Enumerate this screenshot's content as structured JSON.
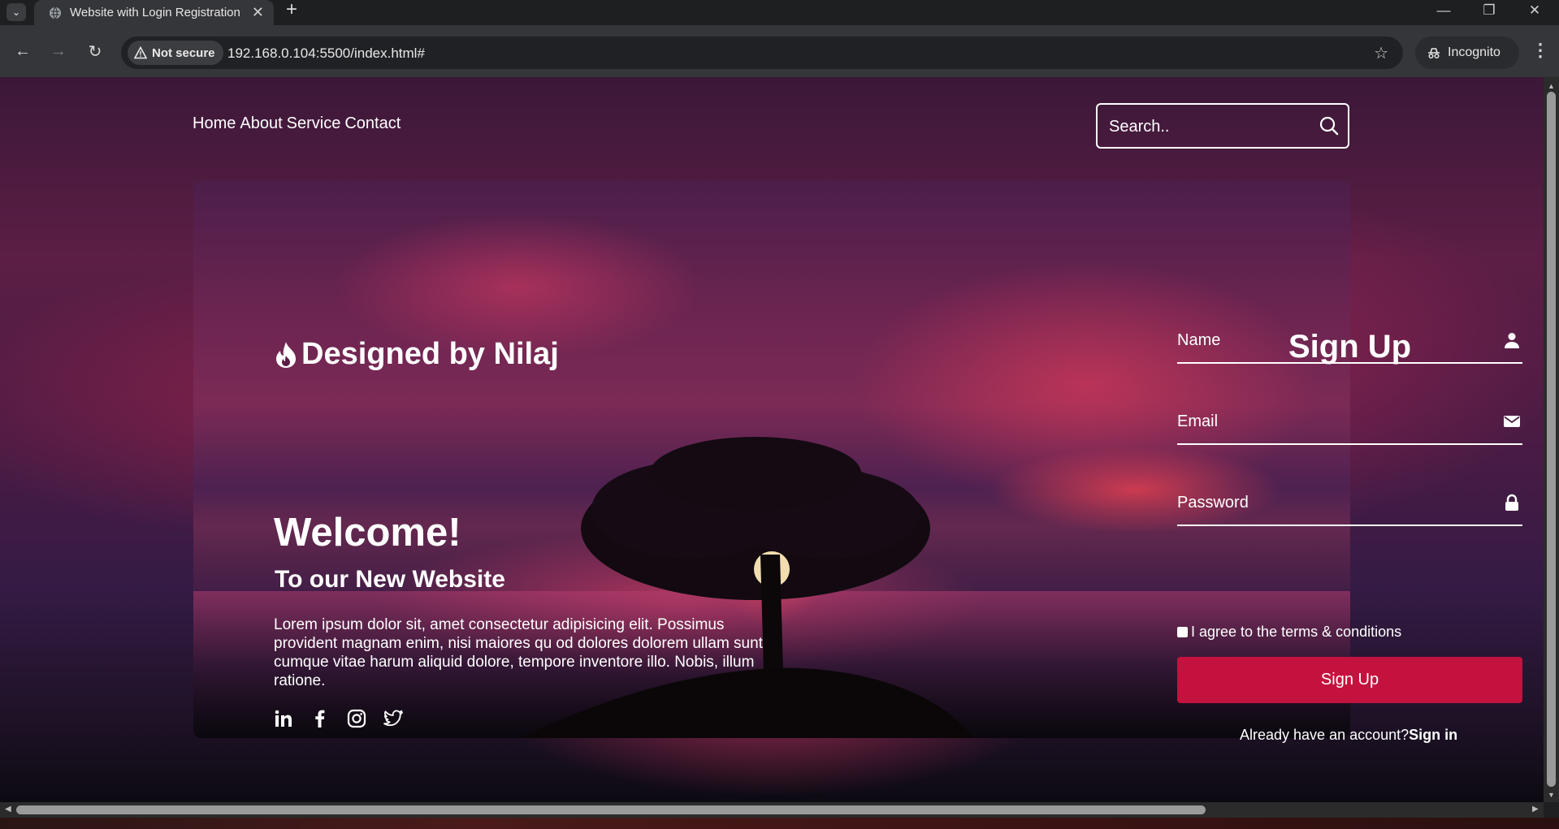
{
  "browser": {
    "tab_title": "Website with Login Registration",
    "security_label": "Not secure",
    "url": "192.168.0.104:5500/index.html#",
    "profile_label": "Incognito"
  },
  "page": {
    "nav": [
      "Home",
      "About",
      "Service",
      "Contact"
    ],
    "search_placeholder": "Search..",
    "brand": "Designed by Nilaj",
    "welcome": "Welcome!",
    "subtitle": "To our New Website",
    "lorem": "Lorem ipsum dolor sit, amet consectetur adipisicing elit. Possimus provident magnam enim, nisi maiores qu od dolores dolorem ullam sunt cumque vitae harum aliquid dolore, tempore inventore illo. Nobis, illum ratione.",
    "socials": [
      "linkedin-icon",
      "facebook-icon",
      "instagram-icon",
      "twitter-icon"
    ],
    "form": {
      "title": "Sign Up",
      "name_label": "Name",
      "email_label": "Email",
      "password_label": "Password",
      "agree_label": "I agree to the terms & conditions",
      "submit_label": "Sign Up",
      "already_text": "Already have an account?",
      "signin_link": "Sign in"
    }
  },
  "colors": {
    "accent": "#c4123e",
    "browser_bg": "#35363a"
  }
}
